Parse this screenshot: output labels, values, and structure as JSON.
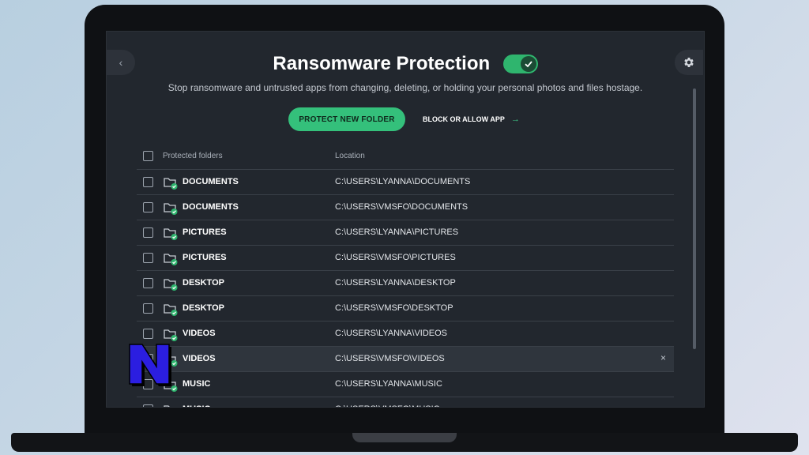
{
  "header": {
    "title": "Ransomware Protection",
    "toggle_on": true,
    "subtitle": "Stop ransomware and untrusted apps from changing, deleting, or holding your personal photos and files hostage."
  },
  "actions": {
    "protect_label": "PROTECT NEW FOLDER",
    "block_label": "BLOCK OR ALLOW APP"
  },
  "table": {
    "col_folders": "Protected folders",
    "col_location": "Location",
    "rows": [
      {
        "name": "DOCUMENTS",
        "location": "C:\\USERS\\LYANNA\\DOCUMENTS"
      },
      {
        "name": "DOCUMENTS",
        "location": "C:\\USERS\\VMSFO\\DOCUMENTS"
      },
      {
        "name": "PICTURES",
        "location": "C:\\USERS\\LYANNA\\PICTURES"
      },
      {
        "name": "PICTURES",
        "location": "C:\\USERS\\VMSFO\\PICTURES"
      },
      {
        "name": "DESKTOP",
        "location": "C:\\USERS\\LYANNA\\DESKTOP"
      },
      {
        "name": "DESKTOP",
        "location": "C:\\USERS\\VMSFO\\DESKTOP"
      },
      {
        "name": "VIDEOS",
        "location": "C:\\USERS\\LYANNA\\VIDEOS"
      },
      {
        "name": "VIDEOS",
        "location": "C:\\USERS\\VMSFO\\VIDEOS"
      },
      {
        "name": "MUSIC",
        "location": "C:\\USERS\\LYANNA\\MUSIC"
      },
      {
        "name": "MUSIC",
        "location": "C:\\USERS\\VMSFO\\MUSIC"
      }
    ]
  },
  "logo": {
    "letter": "N",
    "color": "#2b1ee0"
  },
  "colors": {
    "accent": "#34c07b",
    "background": "#22272e"
  }
}
